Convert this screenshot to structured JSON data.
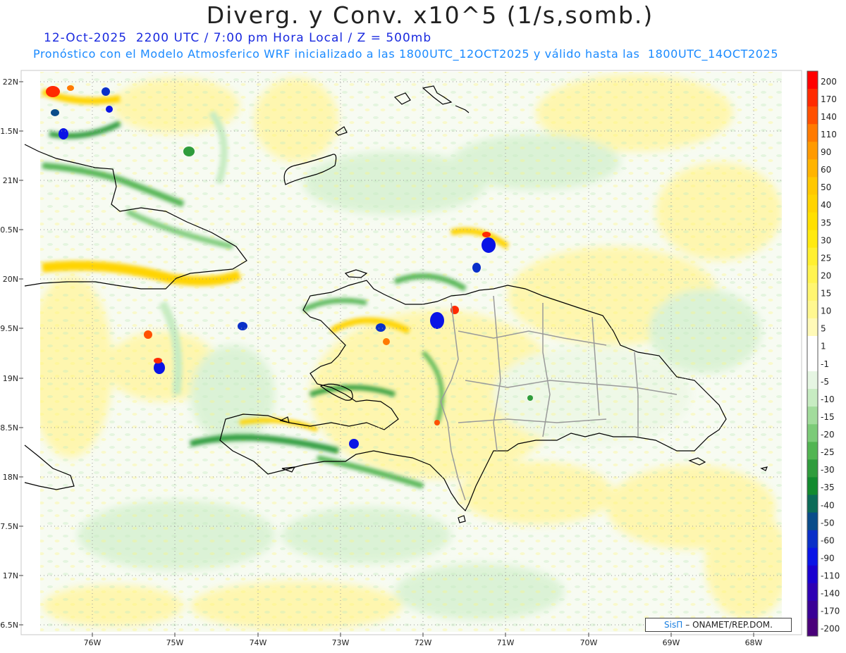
{
  "title": "Diverg. y Conv. x10^5 (1/s,somb.)",
  "subtitle_line1": "12-Oct-2025  2200 UTC / 7:00 pm Hora Local / Z = 500mb",
  "subtitle_line2": "Pronóstico con el Modelo Atmosferico WRF inicializado a las 1800UTC_12OCT2025 y válido hasta las  1800UTC_14OCT2025",
  "credit": {
    "logo_text": "SisΠ",
    "text": "– ONAMET/REP.DOM."
  },
  "lat_labels": [
    "22N",
    "21.5N",
    "21N",
    "20.5N",
    "20N",
    "19.5N",
    "19N",
    "18.5N",
    "18N",
    "17.5N",
    "17N",
    "16.5N"
  ],
  "lat_labels_display": [
    "22N",
    "1.5N",
    "21N",
    "0.5N",
    "20N",
    "9.5N",
    "19N",
    "8.5N",
    "18N",
    "7.5N",
    "17N",
    "6.5N"
  ],
  "lon_labels": [
    "76W",
    "75W",
    "74W",
    "73W",
    "72W",
    "71W",
    "70W",
    "69W",
    "68W"
  ],
  "colorbar": {
    "levels": [
      "200",
      "170",
      "140",
      "110",
      "90",
      "60",
      "50",
      "40",
      "35",
      "30",
      "25",
      "20",
      "15",
      "10",
      "5",
      "1",
      "-1",
      "-5",
      "-10",
      "-15",
      "-20",
      "-25",
      "-30",
      "-35",
      "-40",
      "-50",
      "-60",
      "-90",
      "-110",
      "-140",
      "-170",
      "-200"
    ],
    "colors": [
      "#ff0000",
      "#ff2a00",
      "#ff5000",
      "#ff7a00",
      "#ff9a00",
      "#ffb400",
      "#ffc800",
      "#ffd400",
      "#ffe000",
      "#ffea10",
      "#fff030",
      "#fff450",
      "#fff670",
      "#fff890",
      "#fffab8",
      "#ffffff",
      "#ffffff",
      "#e6f6e3",
      "#c7ecc2",
      "#a2dc9c",
      "#7ccb78",
      "#52b552",
      "#2f9c3c",
      "#128a2e",
      "#0c6b58",
      "#0a4c8a",
      "#0a2fc8",
      "#0a14e6",
      "#1a00d0",
      "#2e00b4",
      "#3a0096",
      "#4a007a"
    ]
  }
}
